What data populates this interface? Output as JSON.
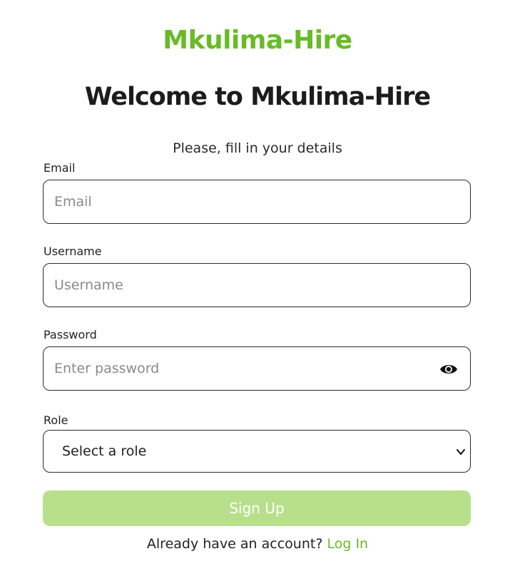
{
  "brand": {
    "name": "Mkulima-Hire",
    "color": "#68bb26"
  },
  "heading": "Welcome to Mkulima-Hire",
  "subtitle": "Please, fill in your details",
  "form": {
    "email": {
      "label": "Email",
      "placeholder": "Email",
      "value": ""
    },
    "username": {
      "label": "Username",
      "placeholder": "Username",
      "value": ""
    },
    "password": {
      "label": "Password",
      "placeholder": "Enter password",
      "value": "",
      "toggle_icon": "eye-icon"
    },
    "role": {
      "label": "Role",
      "selected": "Select a role",
      "icon": "chevron-down-icon"
    },
    "submit_label": "Sign Up",
    "submit_color": "#b8e08c"
  },
  "footer": {
    "prompt": "Already have an account?",
    "link_label": "Log In"
  }
}
